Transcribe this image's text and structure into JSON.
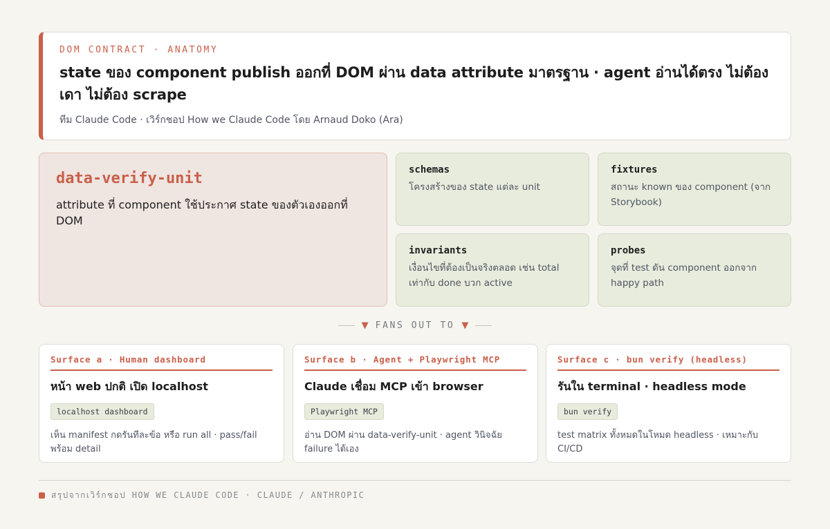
{
  "header": {
    "eyebrow": "DOM CONTRACT · ANATOMY",
    "title": "state ของ component publish ออกที่ DOM ผ่าน data attribute มาตรฐาน · agent อ่านได้ตรง ไม่ต้องเดา ไม่ต้อง scrape",
    "subtitle": "ทีม Claude Code · เวิร์กชอป How we Claude Code โดย Arnaud Doko (Ara)"
  },
  "hero": {
    "name": "data-verify-unit",
    "description": "attribute ที่ component ใช้ประกาศ state ของตัวเองออกที่ DOM"
  },
  "parts": [
    {
      "name": "schemas",
      "description": "โครงสร้างของ state แต่ละ unit"
    },
    {
      "name": "fixtures",
      "description": "สถานะ known ของ component (จาก Storybook)"
    },
    {
      "name": "invariants",
      "description": "เงื่อนไขที่ต้องเป็นจริงตลอด เช่น total เท่ากับ done บวก active"
    },
    {
      "name": "probes",
      "description": "จุดที่ test ดัน component ออกจาก happy path"
    }
  ],
  "fanout": {
    "arrow": "▼",
    "label": "FANS OUT TO"
  },
  "surfaces": [
    {
      "label": "Surface a · Human dashboard",
      "title": "หน้า web ปกติ เปิด localhost",
      "chip": "localhost dashboard",
      "description": "เห็น manifest กดรันทีละข้อ หรือ run all · pass/fail พร้อม detail"
    },
    {
      "label": "Surface b · Agent + Playwright MCP",
      "title": "Claude เชื่อม MCP เข้า browser",
      "chip": "Playwright MCP",
      "description": "อ่าน DOM ผ่าน data-verify-unit · agent วินิจฉัย failure ได้เอง"
    },
    {
      "label": "Surface c · bun verify (headless)",
      "title": "รันใน terminal · headless mode",
      "chip": "bun verify",
      "description": "test matrix ทั้งหมดในโหมด headless · เหมาะกับ CI/CD"
    }
  ],
  "footer": {
    "text": "สรุปจากเวิร์กชอป HOW WE CLAUDE CODE · CLAUDE / ANTHROPIC"
  },
  "colors": {
    "accent": "#c9604a",
    "background": "#f6f5f0",
    "hero_bg": "#efe5e1",
    "part_bg": "#e8ecdd"
  }
}
